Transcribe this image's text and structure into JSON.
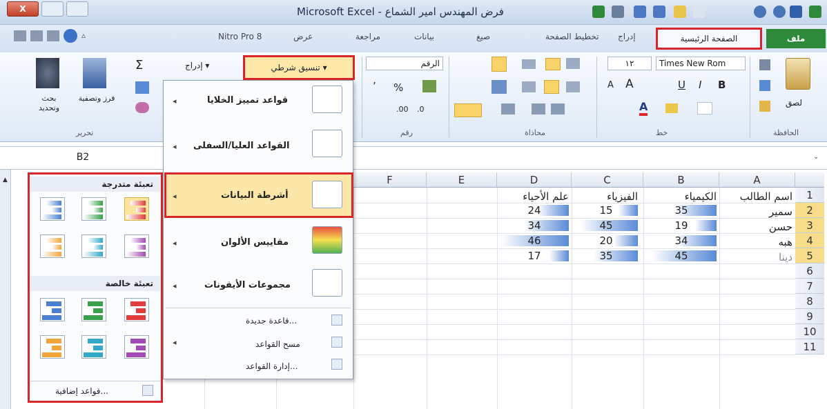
{
  "window": {
    "title": "Microsoft Excel - فرض المهندس امير الشماع",
    "close_label": "X"
  },
  "ribbon_tabs": {
    "file": "ملف",
    "home": "الصفحة الرئيسية",
    "insert": "إدراج",
    "page_layout": "تخطيط الصفحة",
    "formulas": "صيغ",
    "data": "بيانات",
    "review": "مراجعة",
    "view": "عرض",
    "nitro": "Nitro Pro 8"
  },
  "ribbon": {
    "clipboard": {
      "group": "الحافظة",
      "paste": "لصق"
    },
    "font": {
      "group": "خط",
      "name": "Times New Rom",
      "size": "١٢",
      "bold": "B",
      "italic": "I",
      "underline": "U",
      "grow": "A",
      "shrink": "A",
      "font_color": "A"
    },
    "alignment": {
      "group": "محاذاة"
    },
    "number": {
      "group": "رقم",
      "format": "الرقم",
      "percent": "%",
      "comma": "٬",
      "dec_inc": ".00",
      "dec_dec": ".0"
    },
    "styles": {
      "conditional_formatting": "تنسيق شرطي"
    },
    "cells": {
      "insert": "إدراج"
    },
    "editing": {
      "group": "تحرير",
      "sum": "Σ",
      "sort_filter": "فرز وتصفية",
      "find_select": "بحث وتحديد"
    }
  },
  "name_box": "B2",
  "sheet": {
    "columns": [
      "A",
      "B",
      "C",
      "D",
      "E",
      "F"
    ],
    "rows": [
      "1",
      "2",
      "3",
      "4",
      "5",
      "6",
      "7",
      "8",
      "9",
      "10",
      "11"
    ],
    "headers": {
      "A": "اسم الطالب",
      "B": "الكيمياء",
      "C": "الفيزياء",
      "D": "علم الأحياء"
    },
    "data": [
      {
        "name": "سمير",
        "B": 35,
        "C": 15,
        "D": 24
      },
      {
        "name": "حسن",
        "B": 19,
        "C": 45,
        "D": 34
      },
      {
        "name": "هبه",
        "B": 34,
        "C": 20,
        "D": 46
      },
      {
        "name": "دينا",
        "B": 45,
        "C": 35,
        "D": 17
      }
    ],
    "bar_fractions": [
      {
        "B": 0.6,
        "C": 0.3,
        "D": 0.45
      },
      {
        "B": 0.3,
        "C": 0.9,
        "D": 0.65
      },
      {
        "B": 0.58,
        "C": 0.38,
        "D": 0.98
      },
      {
        "B": 0.92,
        "C": 0.7,
        "D": 0.28
      }
    ]
  },
  "cf_menu": {
    "highlight_rules": "قواعد تمييز الخلايا",
    "top_bottom": "القواعد العليا/السفلى",
    "data_bars": "أشرطة البيانات",
    "color_scales": "مقاييس الألوان",
    "icon_sets": "مجموعات الأيقونات",
    "new_rule": "قاعدة جديدة...",
    "clear_rules": "مسح القواعد",
    "manage_rules": "إدارة القواعد..."
  },
  "data_bars_submenu": {
    "gradient_fill": "تعبئة متدرجة",
    "solid_fill": "تعبئة خالصة",
    "more_rules": "قواعد إضافية...",
    "colors": [
      "#4a7fd1",
      "#3aa14a",
      "#e23c3c",
      "#f0a53a",
      "#33a8c9",
      "#a449b8"
    ]
  }
}
